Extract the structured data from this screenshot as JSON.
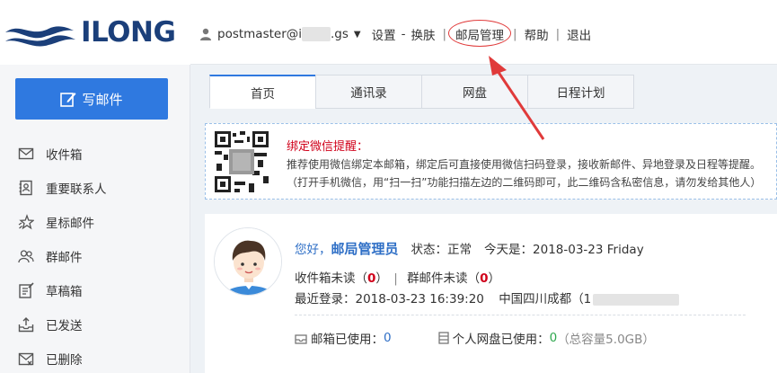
{
  "brand": {
    "name": "ILONG",
    "primary_color": "#2f79e0",
    "accent_red": "#d0021b"
  },
  "header": {
    "user_email_prefix": "postmaster@i",
    "user_email_suffix": ".gs",
    "links": {
      "settings": "设置",
      "dash": "-",
      "skin": "换肤",
      "admin": "邮局管理",
      "help": "帮助",
      "logout": "退出"
    }
  },
  "sidebar": {
    "compose_label": "写邮件",
    "folders": [
      {
        "label": "收件箱",
        "icon": "envelope-icon"
      },
      {
        "label": "重要联系人",
        "icon": "contact-book-icon"
      },
      {
        "label": "星标邮件",
        "icon": "star-icon"
      },
      {
        "label": "群邮件",
        "icon": "group-icon"
      },
      {
        "label": "草稿箱",
        "icon": "draft-icon"
      },
      {
        "label": "已发送",
        "icon": "sent-tray-icon"
      },
      {
        "label": "已删除",
        "icon": "trash-mail-icon"
      }
    ]
  },
  "tabs": [
    {
      "label": "首页",
      "active": true
    },
    {
      "label": "通讯录",
      "active": false
    },
    {
      "label": "网盘",
      "active": false
    },
    {
      "label": "日程计划",
      "active": false
    }
  ],
  "notice": {
    "title": "绑定微信提醒：",
    "line1": "推荐使用微信绑定本邮箱，绑定后可直接使用微信扫码登录，接收新邮件、异地登录及日程等提醒。",
    "line2": "（打开手机微信，用“扫一扫”功能扫描左边的二维码即可，此二维码含私密信息，请勿发给其他人）"
  },
  "welcome": {
    "hello": "您好，",
    "name": "邮局管理员",
    "status_label": "状态：",
    "status_value": "正常",
    "today_label": "今天是：",
    "today_value": "2018-03-23 Friday",
    "inbox_unread_label": "收件箱未读",
    "inbox_unread_open": "（",
    "inbox_unread_count": "0",
    "inbox_unread_close": "）",
    "group_unread_label": "群邮件未读",
    "group_unread_count": "0",
    "last_login_label": "最近登录：",
    "last_login_time": "2018-03-23 16:39:20",
    "last_login_location": "中国四川成都",
    "last_login_ip_open": "（1",
    "mailbox_used_label": "邮箱已使用：",
    "mailbox_used_value": "0",
    "disk_used_label": "个人网盘已使用：",
    "disk_used_value": "0",
    "disk_total": "（总容量5.0GB）"
  }
}
